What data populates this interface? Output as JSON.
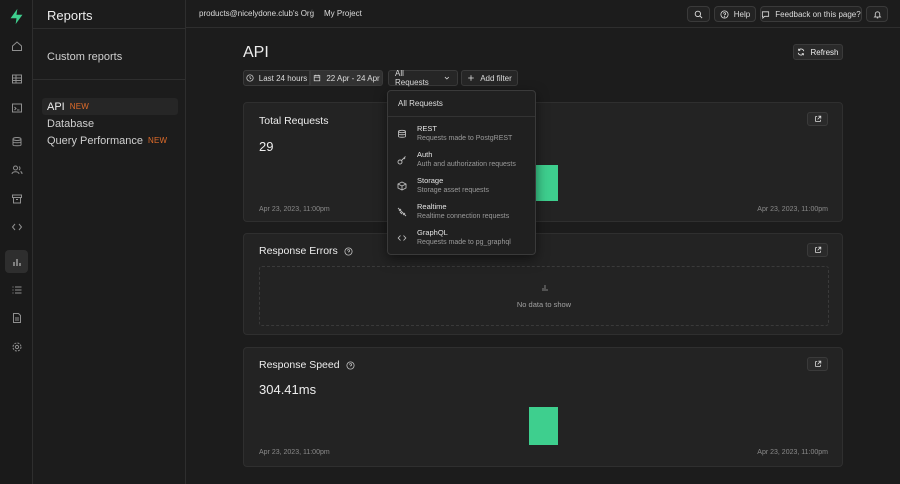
{
  "rail": {
    "icons": [
      "home-icon",
      "table-icon",
      "terminal-icon",
      "database-icon",
      "users-icon",
      "archive-icon",
      "code-icon",
      "reports-icon",
      "list-icon",
      "document-icon",
      "settings-icon"
    ]
  },
  "sidebar": {
    "title": "Reports",
    "custom_reports": "Custom reports",
    "items": [
      {
        "label": "API",
        "badge": "NEW",
        "active": true
      },
      {
        "label": "Database",
        "badge": "",
        "active": false
      },
      {
        "label": "Query Performance",
        "badge": "NEW",
        "active": false
      }
    ]
  },
  "topbar": {
    "org": "products@nicelydone.club's Org",
    "separator": "/",
    "project": "My Project",
    "help": "Help",
    "feedback": "Feedback on this page?"
  },
  "page": {
    "title": "API",
    "refresh": "Refresh"
  },
  "filters": {
    "range_preset": "Last 24 hours",
    "date_range": "22 Apr - 24 Apr",
    "request_type": "All Requests",
    "add_filter": "Add filter"
  },
  "dropdown": {
    "header": "All Requests",
    "options": [
      {
        "label": "REST",
        "sub": "Requests made to PostgREST",
        "icon": "database-icon"
      },
      {
        "label": "Auth",
        "sub": "Auth and authorization requests",
        "icon": "key-icon"
      },
      {
        "label": "Storage",
        "sub": "Storage asset requests",
        "icon": "box-icon"
      },
      {
        "label": "Realtime",
        "sub": "Realtime connection requests",
        "icon": "plug-off-icon"
      },
      {
        "label": "GraphQL",
        "sub": "Requests made to pg_graphql",
        "icon": "code-icon"
      }
    ]
  },
  "cards": {
    "total_requests": {
      "title": "Total Requests",
      "value": "29",
      "x_start": "Apr 23, 2023, 11:00pm",
      "x_end": "Apr 23, 2023, 11:00pm"
    },
    "response_errors": {
      "title": "Response Errors",
      "empty": "No data to show"
    },
    "response_speed": {
      "title": "Response Speed",
      "value": "304.41ms",
      "x_start": "Apr 23, 2023, 11:00pm",
      "x_end": "Apr 23, 2023, 11:00pm"
    }
  },
  "colors": {
    "accent": "#3ecf8e",
    "badge": "#e06c2a"
  }
}
